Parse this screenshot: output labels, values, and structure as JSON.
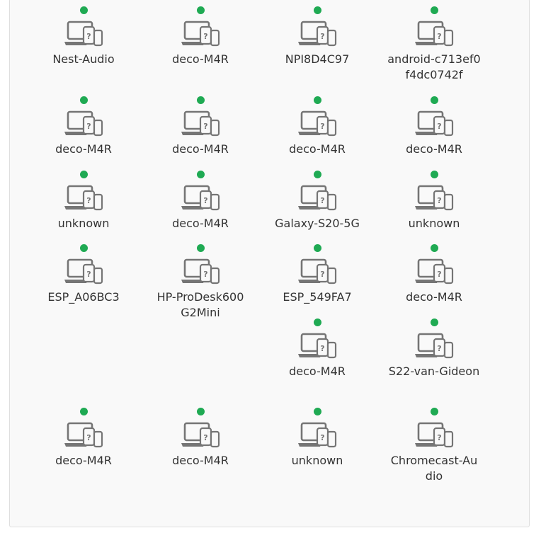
{
  "colors": {
    "online": "#1faa53",
    "icon": "#757575",
    "text": "#333333"
  },
  "status_icon": "online-status-dot",
  "device_icon": "unknown-device-icon",
  "devices": [
    {
      "name": "Nest-Audio"
    },
    {
      "name": "deco-M4R"
    },
    {
      "name": "NPI8D4C97"
    },
    {
      "name": "android-c713ef0f4dc0742f"
    },
    {
      "name": "deco-M4R"
    },
    {
      "name": "deco-M4R"
    },
    {
      "name": "deco-M4R"
    },
    {
      "name": "deco-M4R"
    },
    {
      "name": "unknown"
    },
    {
      "name": "deco-M4R"
    },
    {
      "name": "Galaxy-S20-5G"
    },
    {
      "name": "unknown"
    },
    {
      "name": "ESP_A06BC3"
    },
    {
      "name": "HP-ProDesk600G2Mini"
    },
    {
      "name": "ESP_549FA7"
    },
    {
      "name": "deco-M4R"
    },
    {
      "name": "deco-M4R"
    },
    {
      "name": "S22-van-Gideon"
    },
    {
      "name": "deco-M4R"
    },
    {
      "name": "deco-M4R"
    },
    {
      "name": "unknown"
    },
    {
      "name": "Chromecast-Audio"
    }
  ]
}
